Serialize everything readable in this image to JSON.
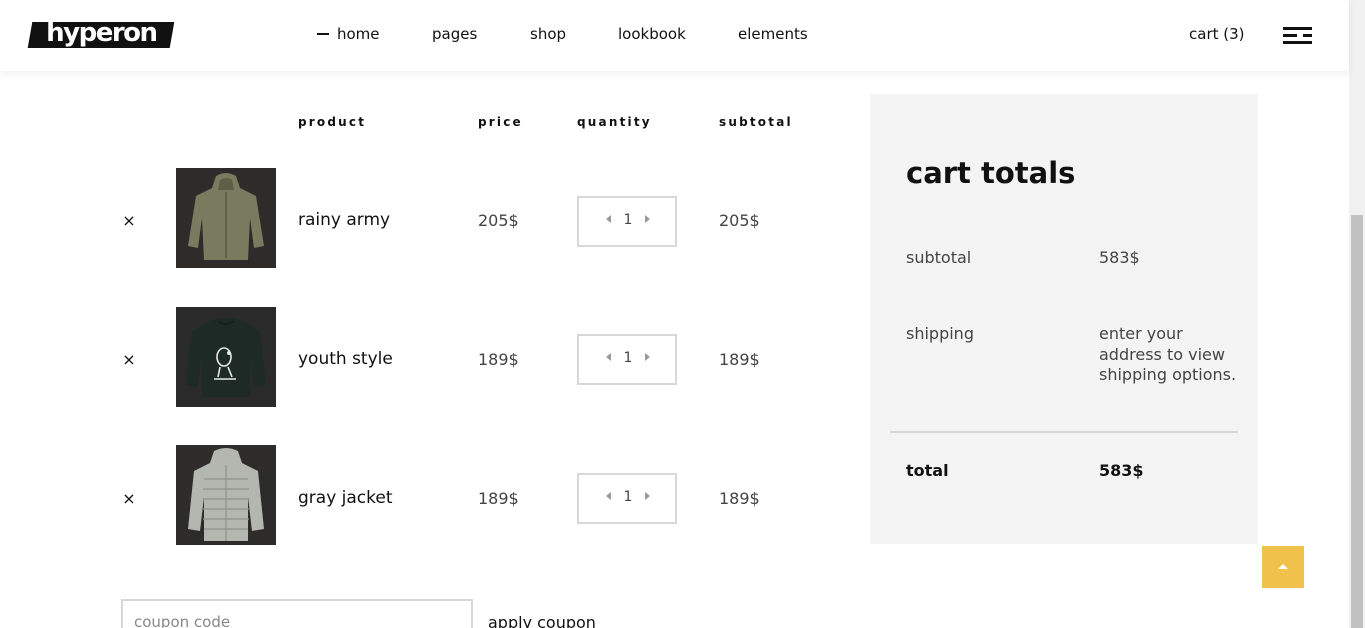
{
  "header": {
    "logo": "hyperon",
    "nav": [
      {
        "label": "home",
        "active": true
      },
      {
        "label": "pages",
        "active": false
      },
      {
        "label": "shop",
        "active": false
      },
      {
        "label": "lookbook",
        "active": false
      },
      {
        "label": "elements",
        "active": false
      }
    ],
    "cart_label": "cart (3)",
    "menu_icon": "hamburger-icon"
  },
  "table": {
    "headers": {
      "product": "product",
      "price": "price",
      "quantity": "quantity",
      "subtotal": "subtotal"
    },
    "rows": [
      {
        "name": "rainy army",
        "price": "205$",
        "quantity": "1",
        "subtotal": "205$",
        "remove": "×"
      },
      {
        "name": "youth style",
        "price": "189$",
        "quantity": "1",
        "subtotal": "189$",
        "remove": "×"
      },
      {
        "name": "gray jacket",
        "price": "189$",
        "quantity": "1",
        "subtotal": "189$",
        "remove": "×"
      }
    ]
  },
  "coupon": {
    "placeholder": "coupon code",
    "apply_label": "apply coupon"
  },
  "totals": {
    "title": "cart totals",
    "subtotal_label": "subtotal",
    "subtotal_value": "583$",
    "shipping_label": "shipping",
    "shipping_value": "enter your address to view shipping options.",
    "total_label": "total",
    "total_value": "583$"
  },
  "colors": {
    "accent": "#f0c14b",
    "panel": "#f4f4f4",
    "text": "#111111"
  }
}
